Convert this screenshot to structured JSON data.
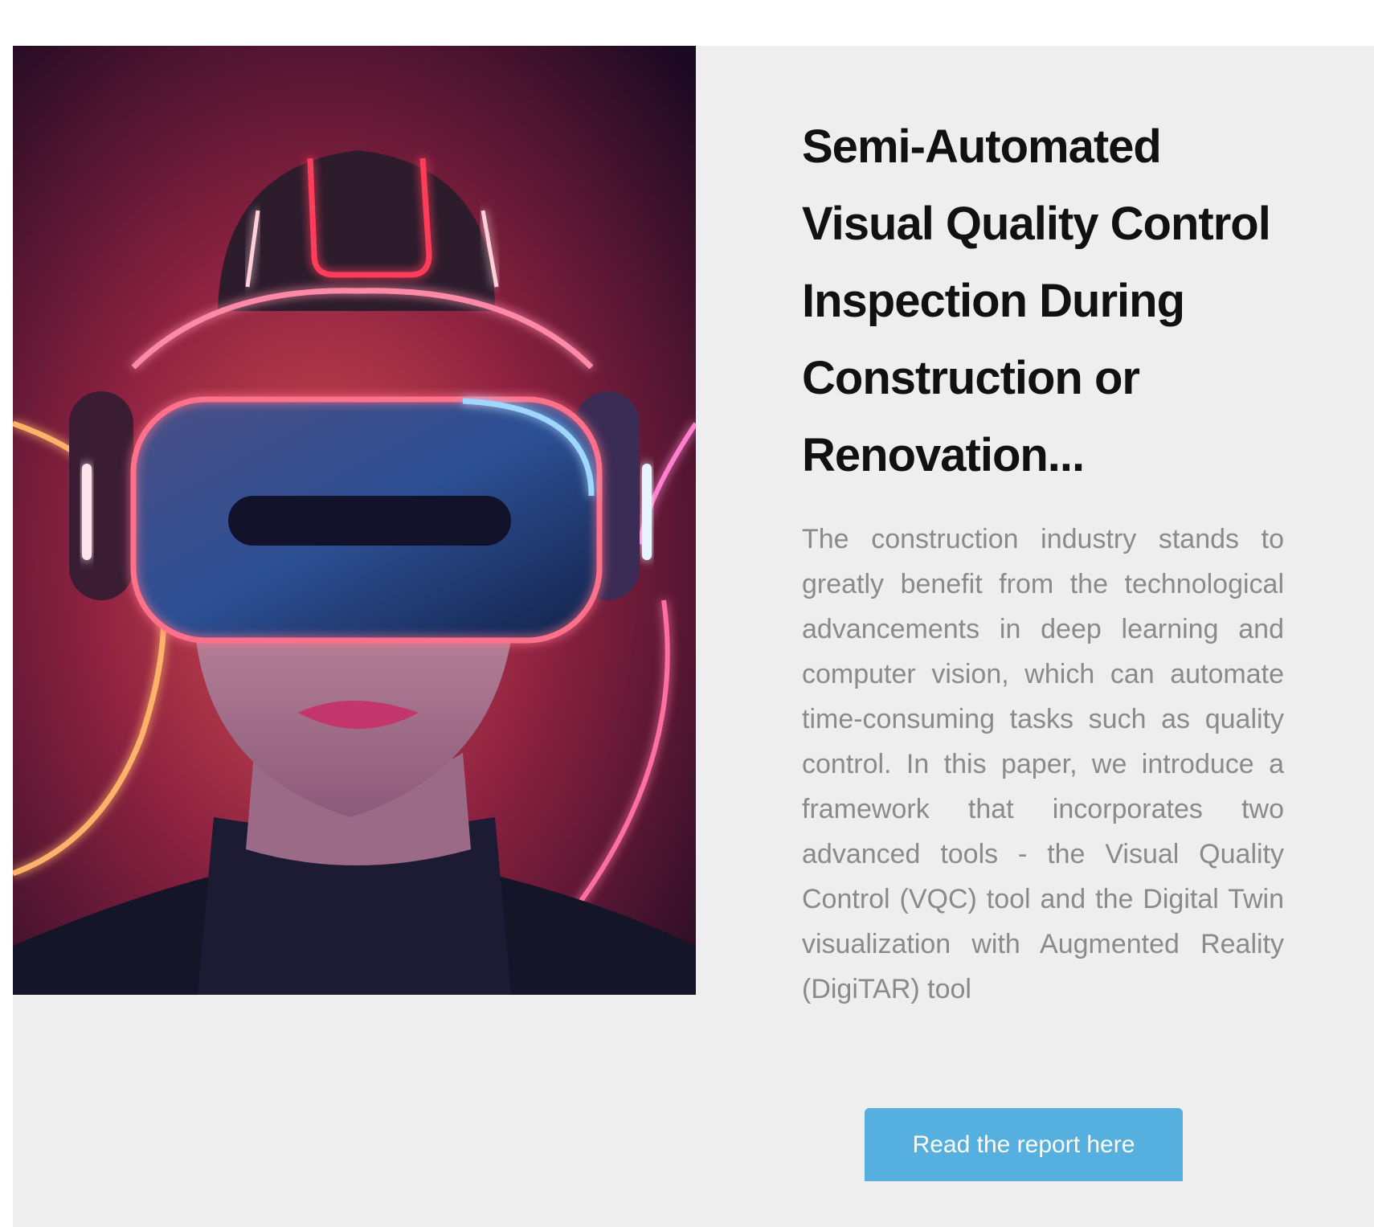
{
  "article": {
    "title": "Semi-Automated Visual Quality Control Inspection During Construction or Renovation...",
    "summary": "The construction industry stands to greatly benefit from the technological advancements in deep learning and computer vision, which can automate time-consuming tasks such as quality control. In this paper, we introduce a framework that incorporates two advanced tools - the Visual Quality Control (VQC) tool and the Digital Twin visualization with Augmented Reality (DigiTAR) tool",
    "cta_label": "Read the report here"
  },
  "colors": {
    "card_background": "#eeeeee",
    "title_text": "#111111",
    "summary_text": "#8a8a8a",
    "button_background": "#55b0df",
    "button_text": "#ffffff"
  }
}
